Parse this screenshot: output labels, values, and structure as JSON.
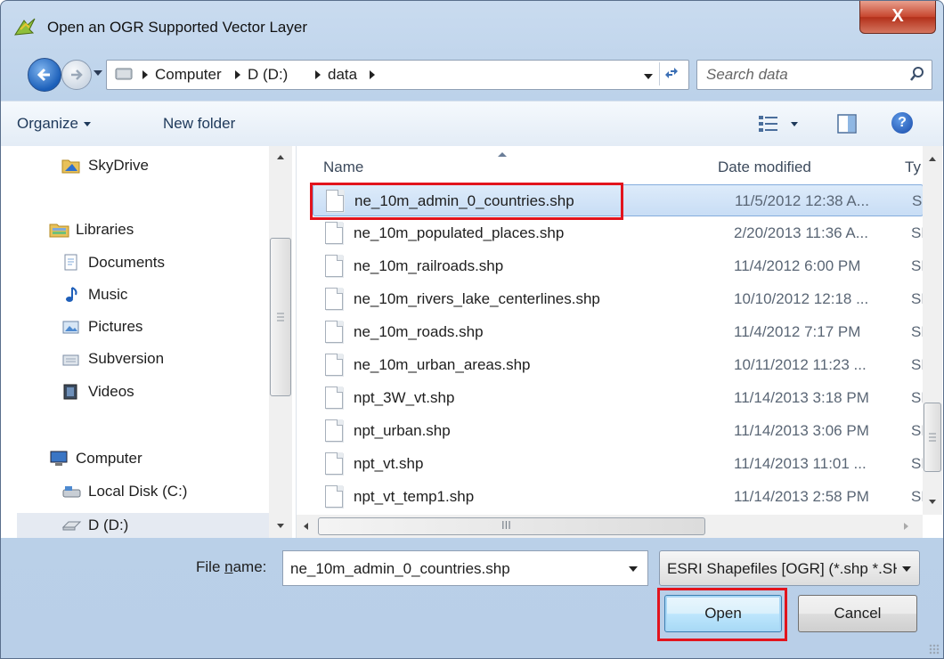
{
  "window": {
    "title": "Open an OGR Supported Vector Layer",
    "close_label": "X"
  },
  "address_bar": {
    "crumbs": [
      "Computer",
      "D (D:)",
      "data"
    ],
    "search_placeholder": "Search data"
  },
  "toolbar": {
    "organize_label": "Organize",
    "new_folder_label": "New folder",
    "help_label": "?"
  },
  "nav_pane": {
    "items": [
      {
        "label": "SkyDrive",
        "icon": "skydrive-folder-icon"
      },
      {
        "label": "Libraries",
        "icon": "libraries-icon"
      },
      {
        "label": "Documents",
        "icon": "documents-icon"
      },
      {
        "label": "Music",
        "icon": "music-icon"
      },
      {
        "label": "Pictures",
        "icon": "pictures-icon"
      },
      {
        "label": "Subversion",
        "icon": "subversion-icon"
      },
      {
        "label": "Videos",
        "icon": "videos-icon"
      },
      {
        "label": "Computer",
        "icon": "computer-icon"
      },
      {
        "label": "Local Disk (C:)",
        "icon": "local-disk-icon"
      },
      {
        "label": "D (D:)",
        "icon": "drive-icon"
      }
    ],
    "selected": "D (D:)"
  },
  "file_list": {
    "columns": {
      "name": "Name",
      "date": "Date modified",
      "type": "Ty"
    },
    "rows": [
      {
        "name": "ne_10m_admin_0_countries.shp",
        "date": "11/5/2012 12:38 A...",
        "type": "SH"
      },
      {
        "name": "ne_10m_populated_places.shp",
        "date": "2/20/2013 11:36 A...",
        "type": "SH"
      },
      {
        "name": "ne_10m_railroads.shp",
        "date": "11/4/2012 6:00 PM",
        "type": "SH"
      },
      {
        "name": "ne_10m_rivers_lake_centerlines.shp",
        "date": "10/10/2012 12:18 ...",
        "type": "SH"
      },
      {
        "name": "ne_10m_roads.shp",
        "date": "11/4/2012 7:17 PM",
        "type": "SH"
      },
      {
        "name": "ne_10m_urban_areas.shp",
        "date": "10/11/2012 11:23 ...",
        "type": "SH"
      },
      {
        "name": "npt_3W_vt.shp",
        "date": "11/14/2013 3:18 PM",
        "type": "SH"
      },
      {
        "name": "npt_urban.shp",
        "date": "11/14/2013 3:06 PM",
        "type": "SH"
      },
      {
        "name": "npt_vt.shp",
        "date": "11/14/2013 11:01 ...",
        "type": "SH"
      },
      {
        "name": "npt_vt_temp1.shp",
        "date": "11/14/2013 2:58 PM",
        "type": "SH"
      }
    ],
    "selected_index": 0,
    "scrollbar_grip": "III"
  },
  "bottom": {
    "file_name_label_prefix": "File ",
    "file_name_label_underlined": "n",
    "file_name_label_suffix": "ame:",
    "file_name_value": "ne_10m_admin_0_countries.shp",
    "filter_value": "ESRI Shapefiles [OGR] (*.shp *.SHP)",
    "open_label": "Open",
    "cancel_label": "Cancel"
  },
  "colors": {
    "highlight_box": "#e2141d",
    "selection": "#cde3f8",
    "chrome": "#bcd2ea"
  }
}
